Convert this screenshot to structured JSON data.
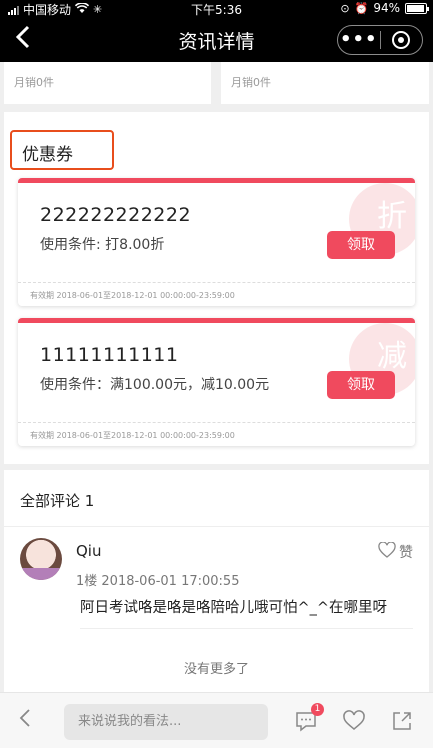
{
  "status_bar": {
    "carrier": "中国移动",
    "time": "下午5:36",
    "battery": "94%"
  },
  "nav": {
    "title": "资讯详情"
  },
  "products": [
    {
      "sales": "月销0件"
    },
    {
      "sales": "月销0件"
    }
  ],
  "coupon_section": {
    "title": "优惠券",
    "coupons": [
      {
        "name": "222222222222",
        "condition": "使用条件: 打8.00折",
        "button": "领取",
        "watermark": "折",
        "validity": "有效期 2018-06-01至2018-12-01 00:00:00-23:59:00"
      },
      {
        "name": "11111111111",
        "condition": "使用条件：满100.00元，减10.00元",
        "button": "领取",
        "watermark": "减",
        "validity": "有效期 2018-06-01至2018-12-01 00:00:00-23:59:00"
      }
    ]
  },
  "comments": {
    "title": "全部评论 1",
    "items": [
      {
        "user": "Qiu",
        "like_label": "赞",
        "meta": "1楼  2018-06-01 17:00:55",
        "text": "阿日考试咯是咯是咯陪哈儿哦可怕^_^在哪里呀"
      }
    ],
    "no_more": "没有更多了"
  },
  "bottom_bar": {
    "input_placeholder": "来说说我的看法...",
    "comment_badge": "1"
  },
  "colors": {
    "accent": "#f04a5e",
    "highlight_border": "#e84d1c"
  }
}
